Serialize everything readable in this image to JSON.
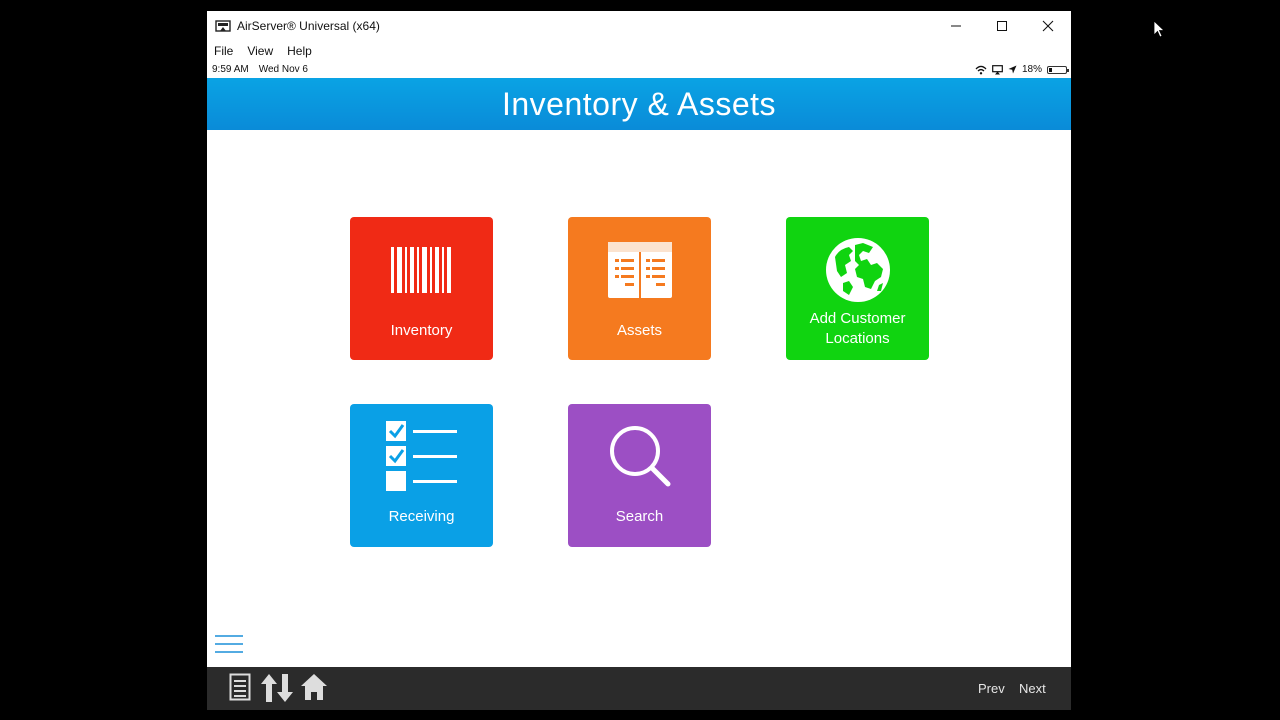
{
  "window": {
    "title": "AirServer® Universal (x64)"
  },
  "menu": [
    {
      "label": "File"
    },
    {
      "label": "View"
    },
    {
      "label": "Help"
    }
  ],
  "status": {
    "time": "9:59 AM",
    "date": "Wed Nov 6",
    "battery": "18%",
    "battery_level": 0.18
  },
  "header": {
    "title": "Inventory & Assets"
  },
  "tiles": [
    {
      "label": "Inventory",
      "color": "#f02a15",
      "icon": "barcode-icon"
    },
    {
      "label": "Assets",
      "color": "#f57a1f",
      "icon": "ledger-icon"
    },
    {
      "label": "Add Customer Locations",
      "color": "#10d410",
      "icon": "globe-icon"
    },
    {
      "label": "Receiving",
      "color": "#0aa0e6",
      "icon": "checklist-icon"
    },
    {
      "label": "Search",
      "color": "#9c4fc4",
      "icon": "search-icon"
    }
  ],
  "bottom": {
    "prev": "Prev",
    "next": "Next"
  }
}
